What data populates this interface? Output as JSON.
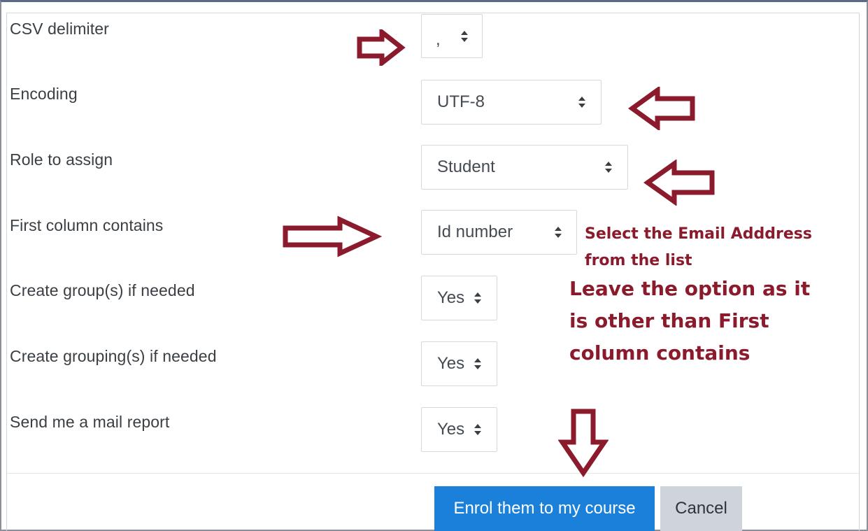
{
  "form": {
    "rows": [
      {
        "label": "CSV delimiter",
        "value": ","
      },
      {
        "label": "Encoding",
        "value": "UTF-8"
      },
      {
        "label": "Role to assign",
        "value": "Student"
      },
      {
        "label": "First column contains",
        "value": "Id number"
      },
      {
        "label": "Create group(s) if needed",
        "value": "Yes"
      },
      {
        "label": "Create grouping(s) if needed",
        "value": "Yes"
      },
      {
        "label": "Send me a mail report",
        "value": "Yes"
      }
    ]
  },
  "annotations": {
    "email_note_line1": "Select the Email Adddress",
    "email_note_line2": "from the list",
    "leave_note_line1": "Leave the option as it",
    "leave_note_line2": "is other than First",
    "leave_note_line3": "column contains",
    "arrow_color": "#8b1a2c"
  },
  "buttons": {
    "submit_label": "Enrol them to my course",
    "cancel_label": "Cancel"
  },
  "colors": {
    "primary": "#1a80d9",
    "secondary": "#ced4da",
    "annotation": "#8b1a2c"
  }
}
